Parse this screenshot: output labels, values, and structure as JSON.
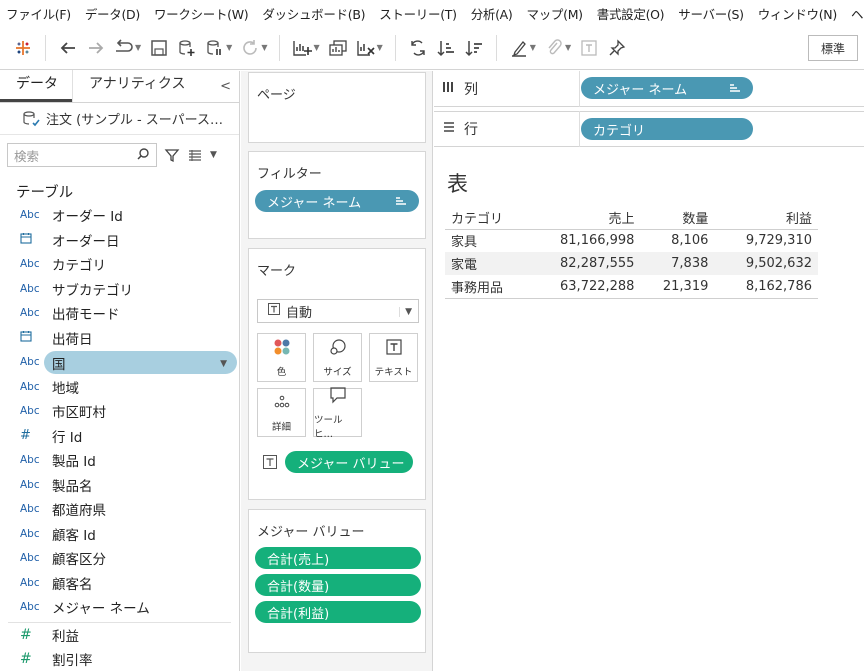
{
  "menu": [
    "ファイル(F)",
    "データ(D)",
    "ワークシート(W)",
    "ダッシュボード(B)",
    "ストーリー(T)",
    "分析(A)",
    "マップ(M)",
    "書式設定(O)",
    "サーバー(S)",
    "ウィンドウ(N)",
    "ヘルプ"
  ],
  "toolbar": {
    "standard_label": "標準",
    "icons": [
      "tableau-logo-icon",
      "back-icon",
      "forward-icon",
      "replay-icon",
      "save-icon",
      "new-datasource-icon",
      "pause-updates-icon",
      "refresh-icon",
      "new-worksheet-icon",
      "duplicate-sheet-icon",
      "clear-sheet-icon",
      "swap-icon",
      "sort-ascending-icon",
      "sort-descending-icon",
      "highlight-icon",
      "paperclip-icon",
      "show-labels-icon",
      "pin-icon"
    ]
  },
  "datapane": {
    "tab_data": "データ",
    "tab_analytics": "アナリティクス",
    "datasource": "注文 (サンプル - スーパース…",
    "search_placeholder": "検索",
    "tables_title": "テーブル",
    "fields": [
      {
        "type": "Abc",
        "name": "オーダー Id"
      },
      {
        "type": "date",
        "name": "オーダー日"
      },
      {
        "type": "Abc",
        "name": "カテゴリ"
      },
      {
        "type": "Abc",
        "name": "サブカテゴリ"
      },
      {
        "type": "Abc",
        "name": "出荷モード"
      },
      {
        "type": "date",
        "name": "出荷日"
      },
      {
        "type": "Abc",
        "name": "国"
      },
      {
        "type": "Abc",
        "name": "地域"
      },
      {
        "type": "Abc",
        "name": "市区町村"
      },
      {
        "type": "#",
        "name": "行 Id"
      },
      {
        "type": "Abc",
        "name": "製品 Id"
      },
      {
        "type": "Abc",
        "name": "製品名"
      },
      {
        "type": "Abc",
        "name": "都道府県"
      },
      {
        "type": "Abc",
        "name": "顧客 Id"
      },
      {
        "type": "Abc",
        "name": "顧客区分"
      },
      {
        "type": "Abc",
        "name": "顧客名"
      },
      {
        "type": "Abc",
        "name": "メジャー ネーム"
      },
      {
        "type": "#",
        "name": "利益"
      },
      {
        "type": "#",
        "name": "割引率"
      }
    ]
  },
  "shelves": {
    "pages": "ページ",
    "filters": "フィルター",
    "filter_pill": "メジャー ネーム",
    "marks": "マーク",
    "marks_type": "自動",
    "mark_buttons": [
      "色",
      "サイズ",
      "テキスト",
      "詳細",
      "ツールヒ…"
    ],
    "marks_pill": "メジャー バリュー",
    "measure_values_title": "メジャー バリュー",
    "measure_values": [
      "合計(売上)",
      "合計(数量)",
      "合計(利益)"
    ],
    "columns_label": "列",
    "columns_pill": "メジャー ネーム",
    "rows_label": "行",
    "rows_pill": "カテゴリ"
  },
  "view": {
    "title": "表",
    "headers": [
      "カテゴリ",
      "売上",
      "数量",
      "利益"
    ],
    "rows": [
      [
        "家具",
        "81,166,998",
        "8,106",
        "9,729,310"
      ],
      [
        "家電",
        "82,287,555",
        "7,838",
        "9,502,632"
      ],
      [
        "事務用品",
        "63,722,288",
        "21,319",
        "8,162,786"
      ]
    ]
  },
  "colors": {
    "dimension_pill": "#4a98b3",
    "measure_pill": "#15b07b",
    "selected_field": "#a8cfe0"
  }
}
